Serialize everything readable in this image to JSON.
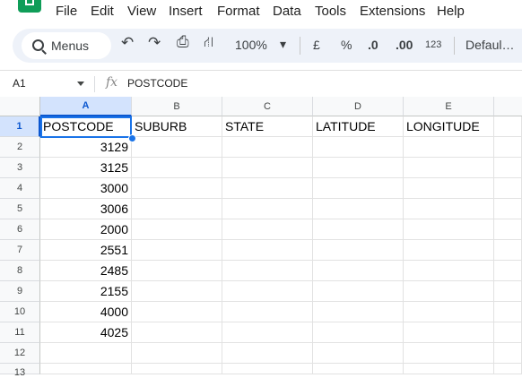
{
  "menu": [
    "File",
    "Edit",
    "View",
    "Insert",
    "Format",
    "Data",
    "Tools",
    "Extensions",
    "Help"
  ],
  "toolbar": {
    "search_label": "Menus",
    "undo": "↶",
    "redo": "↷",
    "print": "⎙",
    "paint": "⛙",
    "zoom": "100%",
    "zoom_arrow": "▾",
    "currency": "£",
    "percent": "%",
    "dec_decrease": ".0",
    "dec_increase": ".00",
    "format_num": "123",
    "font": "Defaul…"
  },
  "formula_bar": {
    "cell_ref": "A1",
    "fx": "fx",
    "content": "POSTCODE"
  },
  "columns": [
    "A",
    "B",
    "C",
    "D",
    "E"
  ],
  "rows": [
    "1",
    "2",
    "3",
    "4",
    "5",
    "6",
    "7",
    "8",
    "9",
    "10",
    "11",
    "12",
    "13"
  ],
  "header_row": [
    "POSTCODE",
    "SUBURB",
    "STATE",
    "LATITUDE",
    "LONGITUDE"
  ],
  "postcodes": [
    "3129",
    "3125",
    "3000",
    "3006",
    "2000",
    "2551",
    "2485",
    "2155",
    "4000",
    "4025"
  ]
}
